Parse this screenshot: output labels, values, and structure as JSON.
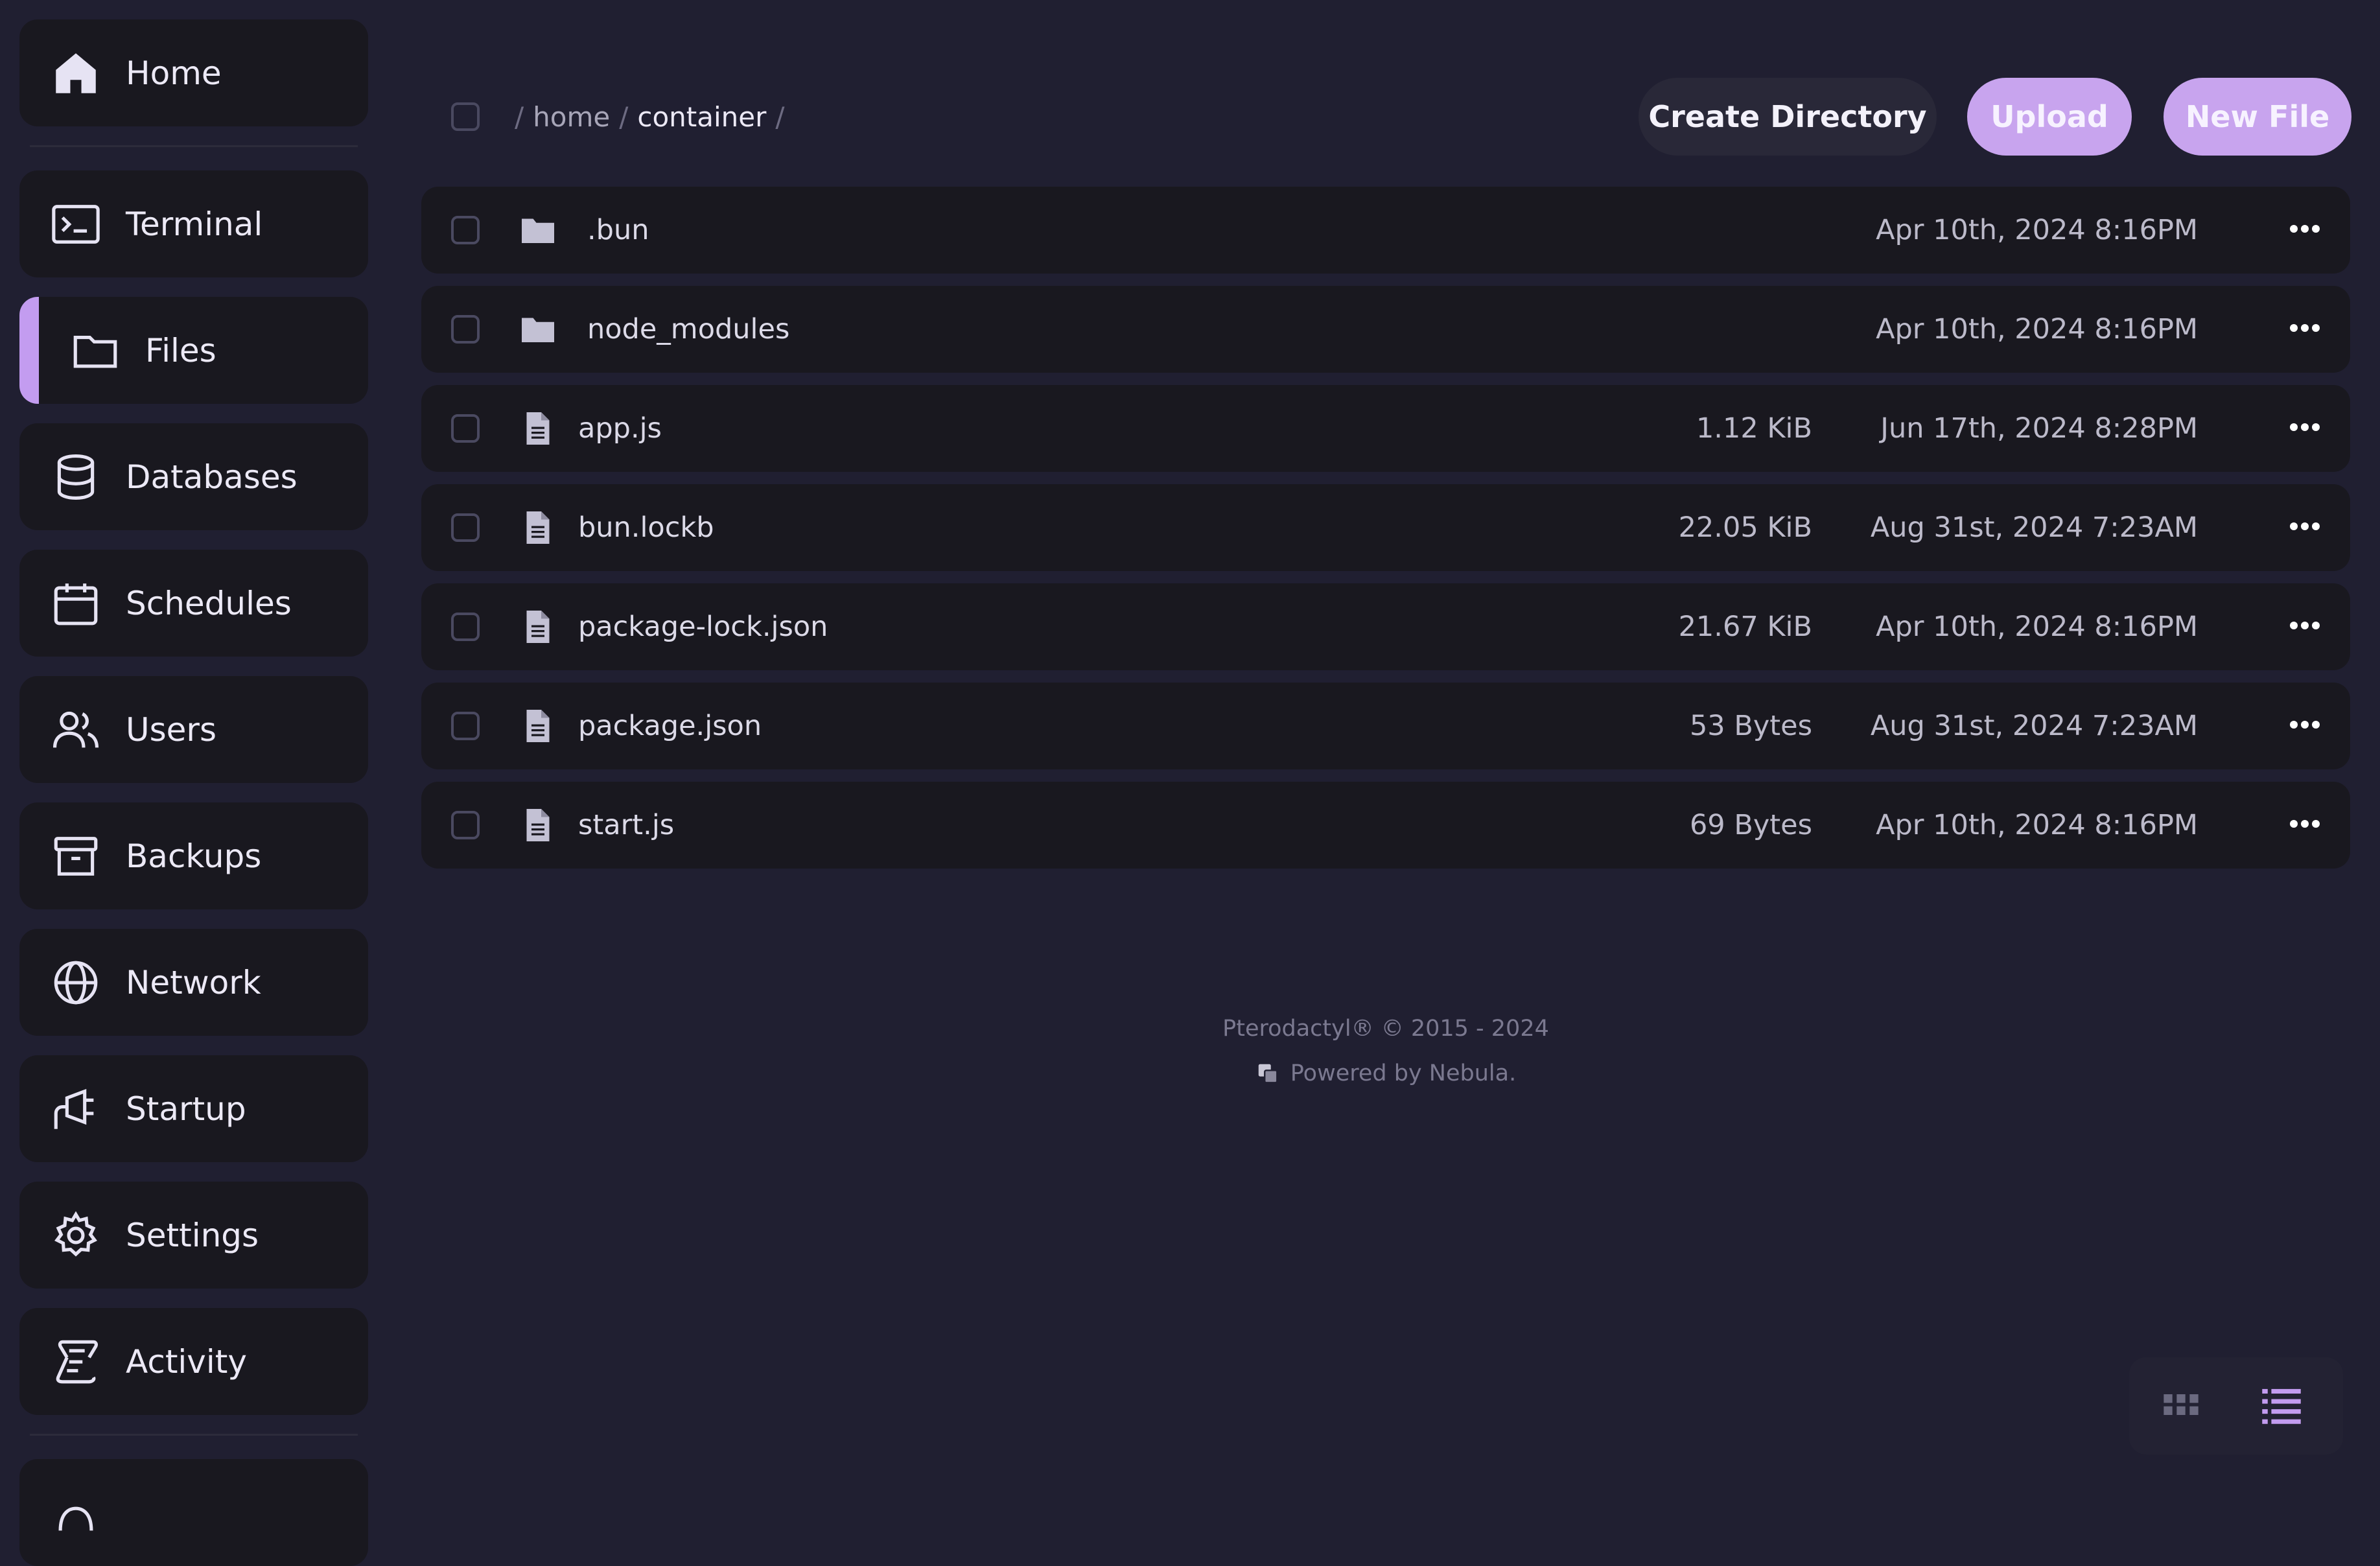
{
  "sidebar": {
    "items": [
      {
        "label": "Home",
        "icon": "home-icon"
      },
      {
        "label": "Terminal",
        "icon": "terminal-icon"
      },
      {
        "label": "Files",
        "icon": "folder-icon",
        "active": true
      },
      {
        "label": "Databases",
        "icon": "database-icon"
      },
      {
        "label": "Schedules",
        "icon": "calendar-icon"
      },
      {
        "label": "Users",
        "icon": "users-icon"
      },
      {
        "label": "Backups",
        "icon": "archive-icon"
      },
      {
        "label": "Network",
        "icon": "globe-icon"
      },
      {
        "label": "Startup",
        "icon": "plug-icon"
      },
      {
        "label": "Settings",
        "icon": "gear-icon"
      },
      {
        "label": "Activity",
        "icon": "scroll-icon"
      }
    ]
  },
  "breadcrumb": {
    "separator": "/",
    "parts": [
      "home",
      "container"
    ]
  },
  "toolbar": {
    "create_directory": "Create Directory",
    "upload": "Upload",
    "new_file": "New File"
  },
  "files": [
    {
      "name": ".bun",
      "type": "folder",
      "size": "",
      "date": "Apr 10th, 2024 8:16PM"
    },
    {
      "name": "node_modules",
      "type": "folder",
      "size": "",
      "date": "Apr 10th, 2024 8:16PM"
    },
    {
      "name": "app.js",
      "type": "file",
      "size": "1.12 KiB",
      "date": "Jun 17th, 2024 8:28PM"
    },
    {
      "name": "bun.lockb",
      "type": "file",
      "size": "22.05 KiB",
      "date": "Aug 31st, 2024 7:23AM"
    },
    {
      "name": "package-lock.json",
      "type": "file",
      "size": "21.67 KiB",
      "date": "Apr 10th, 2024 8:16PM"
    },
    {
      "name": "package.json",
      "type": "file",
      "size": "53 Bytes",
      "date": "Aug 31st, 2024 7:23AM"
    },
    {
      "name": "start.js",
      "type": "file",
      "size": "69 Bytes",
      "date": "Apr 10th, 2024 8:16PM"
    }
  ],
  "footer": {
    "copyright": "Pterodactyl® © 2015 - 2024",
    "powered_by": "Powered by Nebula."
  },
  "view_toggle": {
    "options": [
      "grid-view",
      "list-view"
    ],
    "selected": "list-view"
  },
  "colors": {
    "background": "#201f31",
    "card": "#19181f",
    "accent": "#c8a4ee"
  }
}
